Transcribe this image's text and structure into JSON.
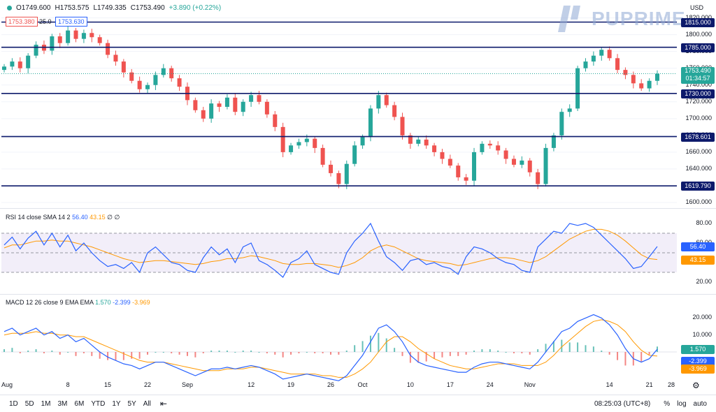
{
  "header": {
    "open": "O1749.600",
    "high": "H1753.575",
    "low": "L1749.335",
    "close": "C1753.490",
    "change": "+3.890 (+0.22%)",
    "sell_price": "1753.380",
    "spread": "25.0",
    "buy_price": "1753.630",
    "currency": "USD",
    "logo_text": "PUPRIME"
  },
  "price_axis": {
    "ticks": [
      {
        "v": 1820,
        "label": "1820.000"
      },
      {
        "v": 1800,
        "label": "1800.000"
      },
      {
        "v": 1780,
        "label": "1780.000"
      },
      {
        "v": 1760,
        "label": "1760.000"
      },
      {
        "v": 1740,
        "label": "1740.000"
      },
      {
        "v": 1720,
        "label": "1720.000"
      },
      {
        "v": 1700,
        "label": "1700.000"
      },
      {
        "v": 1680,
        "label": "1680.000"
      },
      {
        "v": 1660,
        "label": "1660.000"
      },
      {
        "v": 1640,
        "label": "1640.000"
      },
      {
        "v": 1620,
        "label": "1620.000"
      },
      {
        "v": 1600,
        "label": "1600.000"
      }
    ],
    "current_price": "1753.490",
    "countdown": "01:34:57"
  },
  "levels": [
    {
      "v": 1815.0,
      "label": "1815.000"
    },
    {
      "v": 1785.0,
      "label": "1785.000"
    },
    {
      "v": 1730.0,
      "label": "1730.000"
    },
    {
      "v": 1678.601,
      "label": "1678.601"
    },
    {
      "v": 1619.79,
      "label": "1619.790"
    }
  ],
  "rsi": {
    "legend": "RSI 14 close SMA 14 2",
    "value": "56.40",
    "sma": "43.15",
    "extra": "∅ ∅",
    "ticks": [
      {
        "v": 80,
        "label": "80.00"
      },
      {
        "v": 60,
        "label": "60.00"
      },
      {
        "v": 20,
        "label": "20.00"
      }
    ],
    "upper": 70,
    "lower": 30,
    "color": "#2962ff",
    "sma_color": "#ff9800"
  },
  "macd": {
    "legend": "MACD 12 26 close 9 EMA EMA",
    "macd_value": "1.570",
    "signal_value": "-2.399",
    "hist_value": "-3.969",
    "ticks": [
      {
        "v": 20,
        "label": "20.000"
      },
      {
        "v": 10,
        "label": "10.000"
      },
      {
        "v": -10,
        "label": "−10.000"
      }
    ]
  },
  "time_axis": [
    {
      "i": 0,
      "label": "Aug"
    },
    {
      "i": 8,
      "label": "8"
    },
    {
      "i": 13,
      "label": "15"
    },
    {
      "i": 18,
      "label": "22"
    },
    {
      "i": 23,
      "label": "Sep"
    },
    {
      "i": 31,
      "label": "12"
    },
    {
      "i": 36,
      "label": "19"
    },
    {
      "i": 41,
      "label": "26"
    },
    {
      "i": 45,
      "label": "Oct"
    },
    {
      "i": 51,
      "label": "10"
    },
    {
      "i": 56,
      "label": "17"
    },
    {
      "i": 61,
      "label": "24"
    },
    {
      "i": 66,
      "label": "Nov"
    },
    {
      "i": 76,
      "label": "14"
    },
    {
      "i": 81,
      "label": "21"
    },
    {
      "i": 86,
      "label": "28"
    }
  ],
  "toolbar": {
    "timeframes": [
      "1D",
      "5D",
      "1M",
      "3M",
      "6M",
      "YTD",
      "1Y",
      "5Y",
      "All"
    ],
    "clock": "08:25:03 (UTC+8)",
    "percent": "%",
    "log": "log",
    "auto": "auto"
  },
  "chart_data": {
    "type": "candlestick",
    "symbol_period": "Daily",
    "up_color": "#26a69a",
    "down_color": "#ef5350",
    "closes": [
      1762,
      1768,
      1760,
      1775,
      1788,
      1781,
      1798,
      1790,
      1805,
      1795,
      1802,
      1797,
      1790,
      1776,
      1768,
      1755,
      1745,
      1735,
      1740,
      1752,
      1760,
      1748,
      1738,
      1722,
      1710,
      1700,
      1718,
      1714,
      1725,
      1708,
      1720,
      1728,
      1720,
      1705,
      1690,
      1660,
      1668,
      1672,
      1676,
      1665,
      1645,
      1635,
      1622,
      1646,
      1668,
      1678,
      1712,
      1728,
      1716,
      1702,
      1680,
      1670,
      1675,
      1668,
      1660,
      1652,
      1644,
      1630,
      1626,
      1660,
      1670,
      1668,
      1662,
      1652,
      1645,
      1650,
      1636,
      1622,
      1665,
      1680,
      1708,
      1712,
      1760,
      1768,
      1775,
      1782,
      1772,
      1758,
      1752,
      1742,
      1736,
      1745,
      1753.49
    ],
    "rsi_values": [
      58,
      66,
      54,
      65,
      72,
      58,
      70,
      56,
      68,
      52,
      60,
      50,
      42,
      36,
      38,
      34,
      40,
      30,
      50,
      56,
      48,
      40,
      38,
      32,
      30,
      45,
      56,
      48,
      54,
      40,
      56,
      60,
      42,
      38,
      32,
      25,
      40,
      44,
      52,
      38,
      34,
      30,
      28,
      50,
      62,
      70,
      80,
      62,
      46,
      40,
      32,
      42,
      44,
      38,
      40,
      36,
      34,
      28,
      46,
      56,
      54,
      50,
      44,
      40,
      38,
      32,
      30,
      56,
      64,
      72,
      70,
      80,
      78,
      80,
      76,
      68,
      60,
      52,
      44,
      34,
      36,
      46,
      56.4
    ],
    "rsi_sma_values": [
      55,
      58,
      58,
      60,
      62,
      62,
      63,
      62,
      62,
      60,
      58,
      56,
      53,
      50,
      47,
      44,
      42,
      40,
      41,
      42,
      42,
      41,
      40,
      39,
      38,
      39,
      41,
      42,
      44,
      44,
      45,
      47,
      46,
      44,
      42,
      39,
      38,
      38,
      39,
      39,
      38,
      37,
      35,
      37,
      40,
      45,
      52,
      56,
      58,
      56,
      52,
      48,
      44,
      42,
      41,
      40,
      39,
      37,
      38,
      40,
      42,
      44,
      45,
      45,
      44,
      42,
      40,
      42,
      46,
      52,
      58,
      64,
      68,
      72,
      74,
      74,
      72,
      68,
      62,
      55,
      48,
      44,
      43.15
    ],
    "macd_values": [
      12,
      14,
      10,
      12,
      14,
      10,
      12,
      8,
      10,
      6,
      8,
      4,
      0,
      -3,
      -5,
      -7,
      -8,
      -10,
      -8,
      -6,
      -6,
      -8,
      -10,
      -12,
      -14,
      -12,
      -10,
      -10,
      -9,
      -10,
      -9,
      -8,
      -9,
      -11,
      -13,
      -16,
      -15,
      -14,
      -13,
      -14,
      -15,
      -16,
      -17,
      -14,
      -8,
      -2,
      6,
      14,
      16,
      12,
      6,
      -2,
      -6,
      -8,
      -9,
      -10,
      -11,
      -12,
      -12,
      -9,
      -7,
      -6,
      -6,
      -7,
      -8,
      -9,
      -10,
      -6,
      0,
      6,
      12,
      14,
      18,
      20,
      22,
      20,
      16,
      10,
      2,
      -4,
      -6,
      -4,
      1.57
    ],
    "signal_values": [
      10,
      11,
      11,
      11,
      12,
      11,
      11,
      10,
      10,
      9,
      9,
      7,
      5,
      3,
      1,
      -1,
      -3,
      -5,
      -6,
      -6,
      -6,
      -7,
      -8,
      -9,
      -10,
      -11,
      -11,
      -11,
      -10,
      -10,
      -10,
      -9,
      -9,
      -10,
      -11,
      -12,
      -13,
      -13,
      -13,
      -13,
      -14,
      -14,
      -15,
      -15,
      -13,
      -10,
      -6,
      0,
      6,
      9,
      9,
      6,
      2,
      -1,
      -4,
      -6,
      -8,
      -9,
      -10,
      -10,
      -9,
      -8,
      -7,
      -7,
      -7,
      -8,
      -8,
      -8,
      -6,
      -2,
      3,
      7,
      11,
      15,
      18,
      19,
      18,
      16,
      12,
      6,
      1,
      -2,
      -2.399
    ],
    "ylim": [
      1595,
      1828
    ],
    "rsi_ylim": [
      10,
      90
    ],
    "macd_ylim": [
      -14,
      28
    ]
  }
}
